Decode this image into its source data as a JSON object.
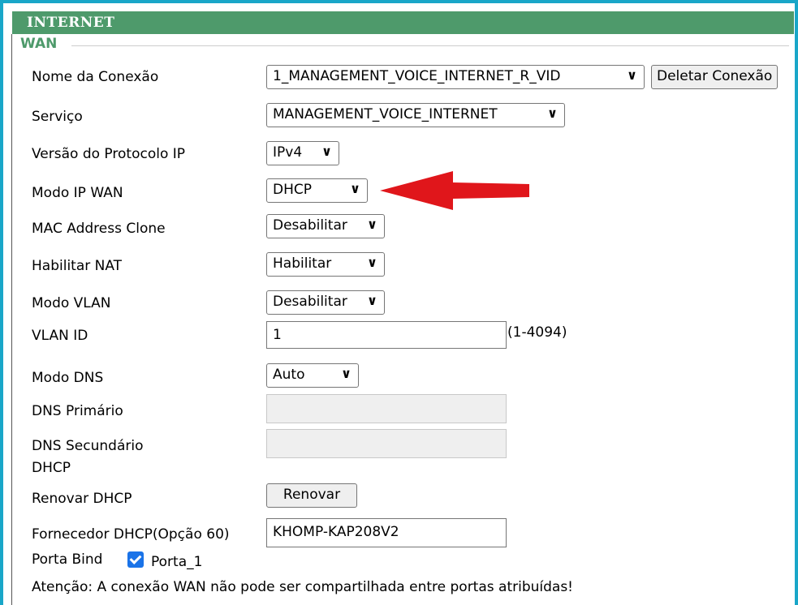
{
  "header": {
    "title": "INTERNET"
  },
  "section": {
    "legend": "WAN"
  },
  "fields": {
    "connection_name": {
      "label": "Nome da Conexão",
      "value": "1_MANAGEMENT_VOICE_INTERNET_R_VID",
      "delete_button": "Deletar Conexão"
    },
    "service": {
      "label": "Serviço",
      "value": "MANAGEMENT_VOICE_INTERNET"
    },
    "ip_version": {
      "label": "Versão do Protocolo IP",
      "value": "IPv4"
    },
    "wan_ip_mode": {
      "label": "Modo IP WAN",
      "value": "DHCP"
    },
    "mac_clone": {
      "label": "MAC Address Clone",
      "value": "Desabilitar"
    },
    "nat": {
      "label": "Habilitar NAT",
      "value": "Habilitar"
    },
    "vlan_mode": {
      "label": "Modo VLAN",
      "value": "Desabilitar"
    },
    "vlan_id": {
      "label": "VLAN ID",
      "value": "1",
      "range": "(1-4094)"
    },
    "dns_mode": {
      "label": "Modo DNS",
      "value": "Auto"
    },
    "dns_primary": {
      "label": "DNS Primário",
      "value": ""
    },
    "dns_secondary": {
      "label": "DNS Secundário",
      "value": ""
    },
    "dhcp_group": {
      "label": "DHCP"
    },
    "dhcp_renew": {
      "label": "Renovar DHCP",
      "button": "Renovar"
    },
    "dhcp_vendor": {
      "label": "Fornecedor DHCP(Opção 60)",
      "value": "KHOMP-KAP208V2"
    },
    "port_bind": {
      "label": "Porta Bind",
      "port_label": "Porta_1",
      "checked": true
    }
  },
  "warning": "Atenção: A conexão WAN não pode ser compartilhada entre portas atribuídas!",
  "colors": {
    "header_bg": "#4e9a6b",
    "frame": "#19a6c8",
    "arrow": "#e0161b",
    "checkbox": "#1a73e8"
  },
  "icons": {
    "select_chevron": "chevron-down-icon",
    "annotation_arrow": "red-arrow-icon"
  }
}
